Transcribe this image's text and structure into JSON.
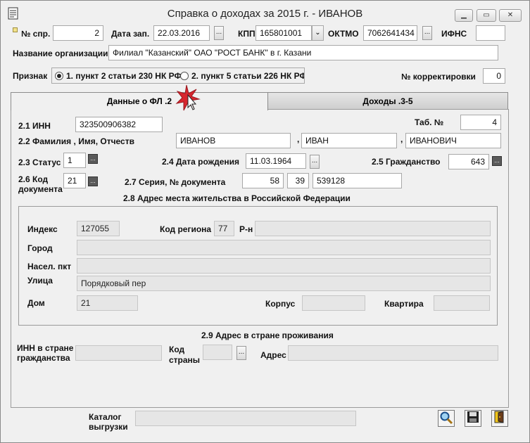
{
  "window": {
    "title": "Справка о доходах за 2015 г. - ИВАНОВ",
    "app_icon": "document-icon",
    "buttons": {
      "minimize": "minimize-icon",
      "maximize": "maximize-icon",
      "close": "close-icon"
    }
  },
  "header": {
    "no_spr_label": "№ спр.",
    "no_spr_value": "2",
    "date_label": "Дата зап.",
    "date_value": "22.03.2016",
    "dots": "...",
    "kpp_label": "КПП",
    "kpp_value": "165801001",
    "oktmo_label": "ОКТМО",
    "oktmo_value": "7062641434",
    "ifns_label": "ИФНС",
    "ifns_value": "",
    "org_label": "Название организации",
    "org_value": "Филиал \"Казанский\" ОАО \"РОСТ БАНК\" в г. Казани",
    "priznak_label": "Признак",
    "priznak_option1": "1. пункт 2 статьи 230 НК РФ",
    "priznak_option2": "2. пункт 5 статьи 226 НК РФ",
    "correction_label": "№ корректировки",
    "correction_value": "0"
  },
  "tabs": [
    {
      "label": "Данные о ФЛ .2"
    },
    {
      "label": "Доходы .3-5"
    }
  ],
  "person": {
    "inn_label": "2.1 ИНН",
    "inn_value": "323500906382",
    "tab_label": "Таб. №",
    "tab_value": "4",
    "fio_label": "2.2 Фамилия , Имя, Отчеств",
    "last_name": "ИВАНОВ",
    "first_name": "ИВАН",
    "middle_name": "ИВАНОВИЧ",
    "comma": ",",
    "status_label": "2.3 Статус",
    "status_value": "1",
    "birth_label": "2.4 Дата рождения",
    "birth_value": "11.03.1964",
    "citizenship_label": "2.5 Гражданство",
    "citizenship_value": "643",
    "doc_code_label_1": "2.6 Код",
    "doc_code_label_2": "документа",
    "doc_code_value": "21",
    "doc_series_label": "2.7 Серия,  № документа",
    "doc_series_1": "58",
    "doc_series_2": "39",
    "doc_number": "539128"
  },
  "address_ru": {
    "title": "2.8 Адрес места жительства в Российской Федерации",
    "index_label": "Индекс",
    "index_value": "127055",
    "region_label": "Код региона",
    "region_value": "77",
    "district_label": "Р-н",
    "district_value": "",
    "city_label": "Город",
    "city_value": "",
    "locality_label": "Насел. пкт",
    "locality_value": "",
    "street_label": "Улица",
    "street_value": "Порядковый пер",
    "house_label": "Дом",
    "house_value": "21",
    "building_label": "Корпус",
    "building_value": "",
    "flat_label": "Квартира",
    "flat_value": ""
  },
  "address_foreign": {
    "title": "2.9 Адрес в стране проживания",
    "inn_label_1": "ИНН в стране",
    "inn_label_2": "гражданства",
    "inn_value": "",
    "country_label_1": "Код",
    "country_label_2": "страны",
    "country_value": "",
    "address_label": "Адрес",
    "address_value": ""
  },
  "footer": {
    "catalog_label_1": "Каталог",
    "catalog_label_2": "выгрузки",
    "catalog_value": "",
    "icons": [
      "search-icon",
      "save-icon",
      "exit-icon"
    ]
  }
}
